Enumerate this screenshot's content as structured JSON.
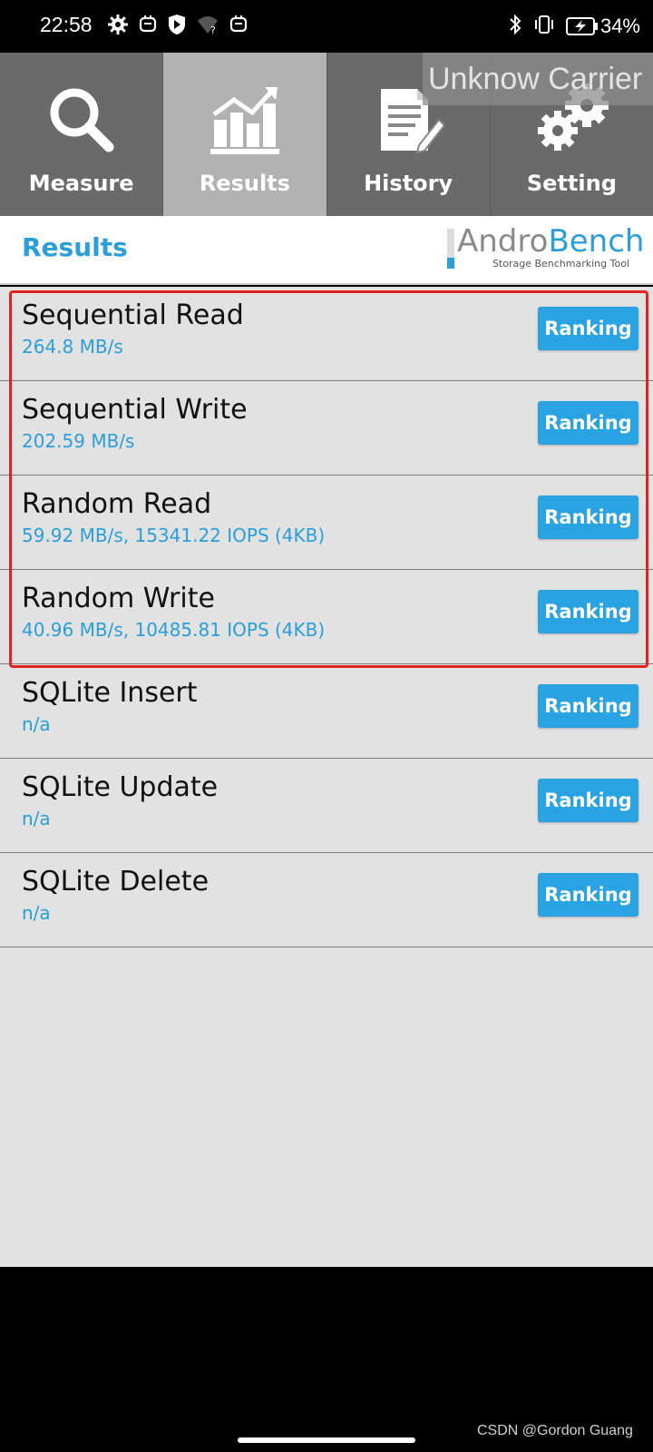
{
  "status_bar": {
    "time": "22:58",
    "battery": "34%",
    "icons_left": [
      "gear-icon",
      "robot-icon",
      "shield-play-icon",
      "wifi-question-icon",
      "robot-icon"
    ],
    "icons_right": [
      "bluetooth-icon",
      "vibrate-icon",
      "battery-charging-icon"
    ]
  },
  "tabs": [
    {
      "label": "Measure",
      "icon": "search-icon"
    },
    {
      "label": "Results",
      "icon": "chart-icon",
      "active": true
    },
    {
      "label": "History",
      "icon": "document-edit-icon"
    },
    {
      "label": "Setting",
      "icon": "gears-icon"
    }
  ],
  "carrier": "Unknow Carrier",
  "header": {
    "title": "Results",
    "logo_part1": "Andro",
    "logo_part2": "Bench",
    "logo_subtitle": "Storage Benchmarking Tool"
  },
  "results": [
    {
      "title": "Sequential Read",
      "value": "264.8 MB/s",
      "button": "Ranking"
    },
    {
      "title": "Sequential Write",
      "value": "202.59 MB/s",
      "button": "Ranking"
    },
    {
      "title": "Random Read",
      "value": "59.92 MB/s, 15341.22 IOPS (4KB)",
      "button": "Ranking"
    },
    {
      "title": "Random Write",
      "value": "40.96 MB/s, 10485.81 IOPS (4KB)",
      "button": "Ranking"
    },
    {
      "title": "SQLite Insert",
      "value": "n/a",
      "button": "Ranking"
    },
    {
      "title": "SQLite Update",
      "value": "n/a",
      "button": "Ranking"
    },
    {
      "title": "SQLite Delete",
      "value": "n/a",
      "button": "Ranking"
    }
  ],
  "watermark": "CSDN @Gordon Guang",
  "colors": {
    "accent": "#2a9fd8",
    "button": "#29a3e2",
    "highlight": "#e02424",
    "tab_bg": "#6a6a6a",
    "tab_active_bg": "#b2b2b2"
  }
}
